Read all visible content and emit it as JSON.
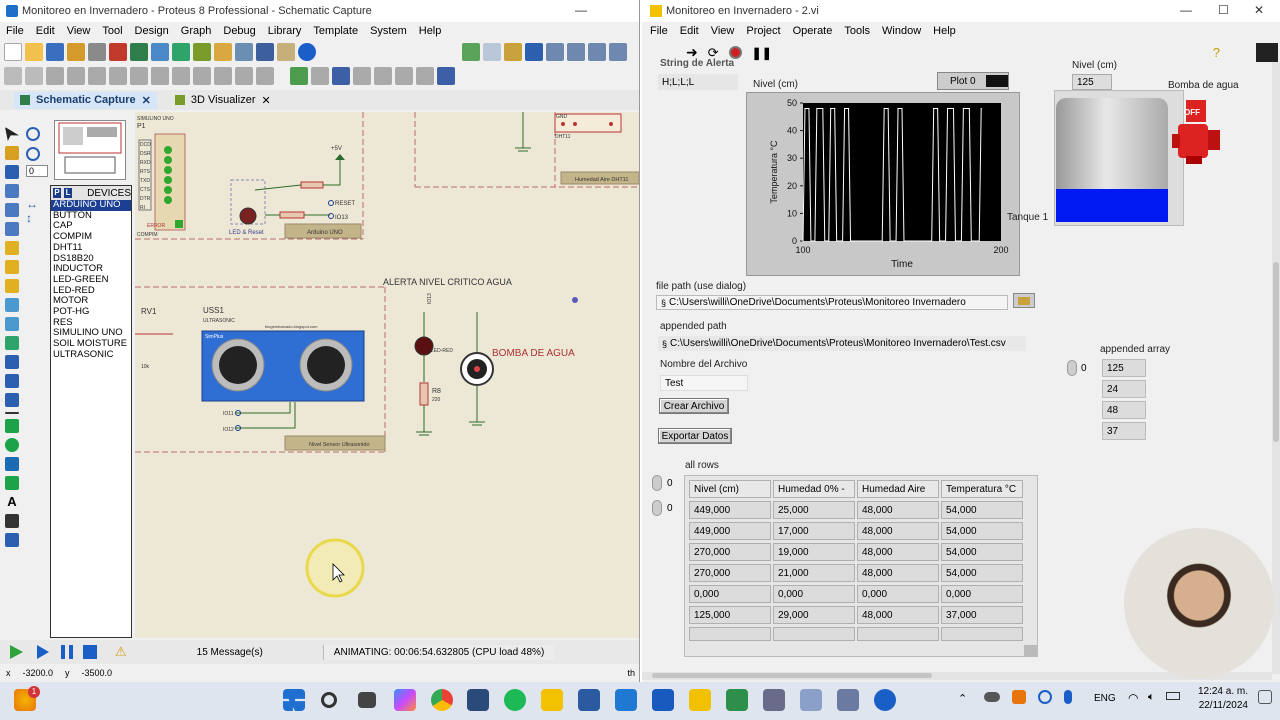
{
  "proteus": {
    "title": "Monitoreo en Invernadero - Proteus 8 Professional - Schematic Capture",
    "menu": [
      "File",
      "Edit",
      "View",
      "Tool",
      "Design",
      "Graph",
      "Debug",
      "Library",
      "Template",
      "System",
      "Help"
    ],
    "tabs": [
      {
        "label": "Schematic Capture",
        "active": true
      },
      {
        "label": "3D Visualizer",
        "active": false
      }
    ],
    "devices_header": "DEVICES",
    "devices": [
      "ARDUINO UNO",
      "BUTTON",
      "CAP",
      "COMPIM",
      "DHT11",
      "DS18B20",
      "INDUCTOR",
      "LED-GREEN",
      "LED-RED",
      "MOTOR",
      "POT-HG",
      "RES",
      "SIMULINO UNO",
      "SOIL MOISTURE",
      "ULTRASONIC"
    ],
    "selected_device": "ARDUINO UNO",
    "schematic": {
      "plus5v": "+5V",
      "reset": "RESET",
      "io13": "IO13",
      "arduino_uno": "Arduino UNO",
      "led_reset": "LED & Reset",
      "error": "ERROR",
      "compim": "COMPIM",
      "simulino_top": "SIMULINO UNO",
      "dht11": "DHT11",
      "gnd": "GND",
      "humedad_aire": "Humedad Aire DHT11",
      "alerta": "ALERTA NIVEL CRITICO AGUA",
      "rv1": "RV1",
      "uss1": "USS1",
      "ultrasonic": "ULTRASONIC",
      "tenk": "10k",
      "simplus": "SimPlus",
      "sensor_site": "blogembarcado.blogspot.com",
      "io11": "IO11",
      "io12": "IO12",
      "nivel_sensor": "Nivel Sensor Ultrasonido",
      "led_red": "LED-RED",
      "r8": "R8",
      "r8_val": "220",
      "bomba": "BOMBA DE AGUA",
      "pins": [
        "DCD",
        "DSR",
        "RXD",
        "RTS",
        "TXD",
        "CTS",
        "DTR",
        "RI"
      ]
    },
    "status": {
      "messages": "15 Message(s)",
      "animating": "ANIMATING: 00:06:54.632805 (CPU load 48%)",
      "th": "th"
    },
    "coords": {
      "x_label": "x",
      "x": "-3200.0",
      "y_label": "y",
      "y": "-3500.0"
    },
    "zoom_field": "0"
  },
  "labview": {
    "title": "Monitoreo en Invernadero - 2.vi",
    "menu": [
      "File",
      "Edit",
      "View",
      "Project",
      "Operate",
      "Tools",
      "Window",
      "Help"
    ],
    "string_alerta_label": "String de Alerta",
    "string_alerta_value": "H;L;L;L",
    "nivel_cm_label": "Nivel (cm)",
    "plot_label": "Plot 0",
    "chart_ylabel": "Temperatura °C",
    "chart_xlabel": "Time",
    "nivel_indicator_label": "Nivel (cm)",
    "nivel_indicator_value": "125",
    "bomba_label": "Bomba de agua",
    "bomba_state": "OFF",
    "tanque_label": "Tanque 1",
    "file_path_label": "file path (use dialog)",
    "file_path_value": "C:\\Users\\willi\\OneDrive\\Documents\\Proteus\\Monitoreo Invernadero",
    "appended_path_label": "appended path",
    "appended_path_value": "C:\\Users\\willi\\OneDrive\\Documents\\Proteus\\Monitoreo Invernadero\\Test.csv",
    "nombre_label": "Nombre del Archivo",
    "nombre_value": "Test",
    "crear_btn": "Crear Archivo",
    "exportar_btn": "Exportar Datos",
    "appended_array_label": "appended array",
    "array_index": "0",
    "appended_array": [
      "125",
      "24",
      "48",
      "37"
    ],
    "all_rows_label": "all rows",
    "row_index": "0",
    "col_index": "0",
    "table_headers": [
      "Nivel (cm)",
      "Humedad 0% -",
      "Humedad Aire",
      "Temperatura °C"
    ],
    "table_rows": [
      [
        "449,000",
        "25,000",
        "48,000",
        "54,000"
      ],
      [
        "449,000",
        "17,000",
        "48,000",
        "54,000"
      ],
      [
        "270,000",
        "19,000",
        "48,000",
        "54,000"
      ],
      [
        "270,000",
        "21,000",
        "48,000",
        "54,000"
      ],
      [
        "0,000",
        "0,000",
        "0,000",
        "0,000"
      ],
      [
        "125,000",
        "29,000",
        "48,000",
        "37,000"
      ]
    ],
    "tank_level_fraction": 0.27
  },
  "chart_data": {
    "type": "line",
    "title": "",
    "xlabel": "Time",
    "ylabel": "Temperatura °C",
    "xlim": [
      100,
      200
    ],
    "ylim": [
      0,
      50
    ],
    "x_ticks": [
      "100",
      "200"
    ],
    "y_ticks": [
      "0",
      "10",
      "20",
      "30",
      "40",
      "50"
    ],
    "legend": [
      "Plot 0"
    ],
    "series": [
      {
        "x": [
          100,
          101,
          103,
          104,
          106,
          107,
          110,
          111,
          113,
          114,
          116,
          117,
          120,
          121,
          123,
          124,
          140,
          141,
          143,
          144,
          147,
          148,
          150,
          151,
          165,
          166,
          168,
          169,
          172,
          173,
          176,
          177,
          180,
          181,
          184,
          185,
          189,
          190
        ],
        "y": [
          0,
          48,
          48,
          0,
          0,
          48,
          48,
          0,
          0,
          48,
          48,
          0,
          0,
          48,
          48,
          0,
          0,
          48,
          48,
          0,
          0,
          48,
          48,
          0,
          0,
          48,
          48,
          0,
          0,
          48,
          48,
          0,
          0,
          48,
          48,
          0,
          0,
          48
        ]
      }
    ]
  },
  "taskbar": {
    "lang": "ENG",
    "time": "12:24 a. m.",
    "date": "22/11/2024",
    "notif": "1"
  }
}
